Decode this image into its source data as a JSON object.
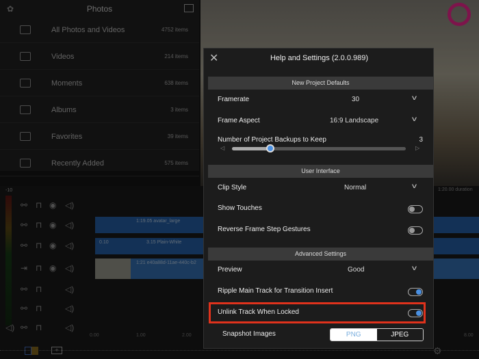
{
  "photos": {
    "title": "Photos",
    "items": [
      {
        "label": "All Photos and Videos",
        "count": "4752 items",
        "icon": "folder-icon"
      },
      {
        "label": "Videos",
        "count": "214 items",
        "icon": "video-camera-icon"
      },
      {
        "label": "Moments",
        "count": "638 items",
        "icon": "camera-icon"
      },
      {
        "label": "Albums",
        "count": "3 items",
        "icon": "album-icon"
      },
      {
        "label": "Favorites",
        "count": "39 items",
        "icon": "heart-icon"
      },
      {
        "label": "Recently Added",
        "count": "575 items",
        "icon": "folder-icon"
      }
    ]
  },
  "timeline": {
    "meter_label": "-10",
    "duration": "1:20.00 duration",
    "clips": [
      {
        "label": "1:19.05  avatar_large"
      },
      {
        "prefix": "0.10",
        "label": "3.15  Plain-White"
      },
      {
        "label": "1:21  e40a88d-11ae-440c-b2"
      }
    ],
    "ruler": [
      "0.00",
      "1.00",
      "2.00",
      "8.00"
    ]
  },
  "dialog": {
    "title": "Help and Settings (2.0.0.989)",
    "sections": {
      "defaults": "New Project Defaults",
      "ui": "User Interface",
      "advanced": "Advanced Settings"
    },
    "framerate": {
      "label": "Framerate",
      "value": "30"
    },
    "aspect": {
      "label": "Frame Aspect",
      "value": "16:9  Landscape"
    },
    "backups": {
      "label": "Number of Project Backups to Keep",
      "value": "3",
      "min": 1,
      "max": 10
    },
    "clip_style": {
      "label": "Clip Style",
      "value": "Normal"
    },
    "show_touches": {
      "label": "Show Touches",
      "on": false
    },
    "reverse": {
      "label": "Reverse Frame Step Gestures",
      "on": false
    },
    "preview": {
      "label": "Preview",
      "value": "Good"
    },
    "ripple": {
      "label": "Ripple Main Track for Transition Insert",
      "on": true
    },
    "unlink": {
      "label": "Unlink Track When Locked",
      "on": true
    },
    "snapshot": {
      "label": "Snapshot Images",
      "options": [
        "PNG",
        "JPEG"
      ],
      "selected": "JPEG"
    },
    "highlight_color": "#e0321c",
    "accent": "#4a90e2"
  }
}
